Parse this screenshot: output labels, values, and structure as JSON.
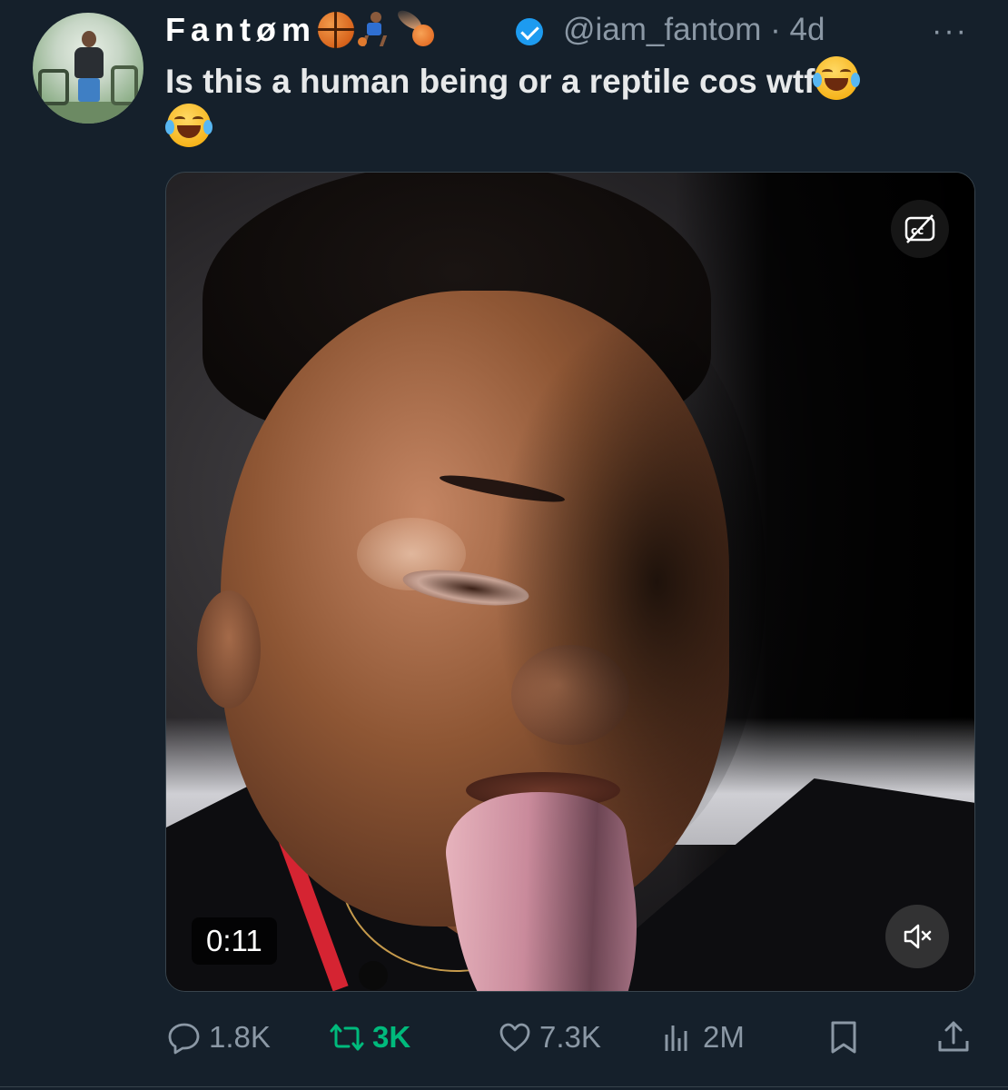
{
  "tweet": {
    "author": {
      "display_name": "Fantøm",
      "name_emojis": [
        "basketball-emoji",
        "person-bouncing-ball-emoji",
        "basketball-comet-emoji"
      ],
      "verified": true,
      "handle": "@iam_fantom",
      "separator": "·",
      "time": "4d"
    },
    "more_label": "···",
    "text": "Is this a human being or a reptile cos wtf",
    "text_emojis": [
      "face-with-tears-of-joy-emoji",
      "face-with-tears-of-joy-emoji"
    ],
    "media": {
      "type": "video",
      "duration": "0:11",
      "captions_icon": "cc-off-icon",
      "muted": true,
      "mute_icon": "speaker-muted-icon"
    },
    "actions": {
      "reply": {
        "count": "1.8K",
        "icon": "reply-icon"
      },
      "retweet": {
        "count": "3K",
        "icon": "retweet-icon",
        "active": true,
        "color": "#00ba7c"
      },
      "like": {
        "count": "7.3K",
        "icon": "heart-icon"
      },
      "views": {
        "count": "2M",
        "icon": "views-icon"
      },
      "bookmark": {
        "icon": "bookmark-icon"
      },
      "share": {
        "icon": "share-icon"
      }
    }
  },
  "colors": {
    "background": "#15202b",
    "primary_text": "#e7e9ea",
    "secondary_text": "#8b98a5",
    "verified_blue": "#1d9bf0",
    "retweet_green": "#00ba7c"
  }
}
